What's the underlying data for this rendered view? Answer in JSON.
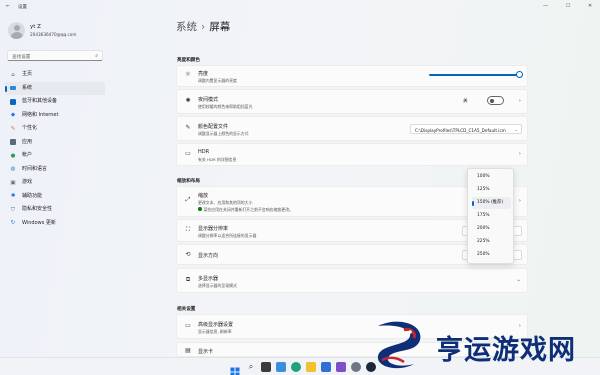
{
  "window": {
    "title": "设置",
    "back_icon": "arrow-left-icon",
    "controls": [
      "minimize-icon",
      "maximize-icon",
      "close-icon"
    ]
  },
  "user": {
    "name": "yt Z",
    "email": "2043636470@qq.com"
  },
  "search": {
    "placeholder": "查找设置"
  },
  "nav": {
    "items": [
      {
        "label": "主页",
        "icon": "home-icon"
      },
      {
        "label": "系统",
        "icon": "system-icon",
        "active": true
      },
      {
        "label": "蓝牙和其他设备",
        "icon": "bluetooth-icon"
      },
      {
        "label": "网络和 Internet",
        "icon": "wifi-icon"
      },
      {
        "label": "个性化",
        "icon": "brush-icon"
      },
      {
        "label": "应用",
        "icon": "apps-icon"
      },
      {
        "label": "帐户",
        "icon": "account-icon"
      },
      {
        "label": "时间和语言",
        "icon": "globe-clock-icon"
      },
      {
        "label": "游戏",
        "icon": "gamepad-icon"
      },
      {
        "label": "辅助功能",
        "icon": "accessibility-icon"
      },
      {
        "label": "隐私和安全性",
        "icon": "shield-icon"
      },
      {
        "label": "Windows 更新",
        "icon": "update-icon"
      }
    ]
  },
  "breadcrumb": {
    "parent": "系统",
    "separator": "›",
    "current": "屏幕"
  },
  "sections": {
    "brightness_color": "亮度和颜色",
    "scale_layout": "缩放和布局",
    "related": "相关设置"
  },
  "settings": {
    "brightness": {
      "title": "亮度",
      "subtitle": "调整内置显示器的亮度",
      "value": 1.0
    },
    "night_light": {
      "title": "夜间模式",
      "subtitle": "使用较暖的颜色来帮助阻挡蓝光",
      "state": "关"
    },
    "color_profile": {
      "title": "颜色配置文件",
      "subtitle": "调整显示器上颜色的显示方式",
      "value": "C:\\DisplayProfiles\\TPLCD_C1A5_Default.icm"
    },
    "hdr": {
      "title": "HDR",
      "subtitle": "有关 HDR 的详细信息"
    },
    "scale": {
      "title": "缩放",
      "subtitle": "更改文本、应用和其他项的大小",
      "warning": "某些应用在关闭并重新打开之前不会响应缩放更改。"
    },
    "resolution": {
      "title": "显示器分辨率",
      "subtitle": "调整分辨率以适合所连接的显示器"
    },
    "orientation": {
      "title": "显示方向"
    },
    "multi_display": {
      "title": "多显示器",
      "subtitle": "选择显示器的呈现模式"
    },
    "advanced_display": {
      "title": "高级显示器设置",
      "subtitle": "显示器信息, 刷新率"
    },
    "graphics": {
      "title": "显示卡"
    }
  },
  "scale_options": [
    "100%",
    "125%",
    "150% (推荐)",
    "175%",
    "200%",
    "225%",
    "250%"
  ],
  "scale_selected": "150% (推荐)",
  "taskbar": {
    "icons": [
      "start-icon",
      "search-icon",
      "task-view-icon",
      "widgets-icon",
      "edge-icon",
      "explorer-icon",
      "store-icon",
      "app-icon",
      "settings-icon",
      "steam-icon"
    ]
  },
  "watermark": {
    "text": "亨运游戏网",
    "logo": "dragon-logo"
  },
  "colors": {
    "accent": "#0067c0",
    "watermark": "#0e2f78"
  }
}
